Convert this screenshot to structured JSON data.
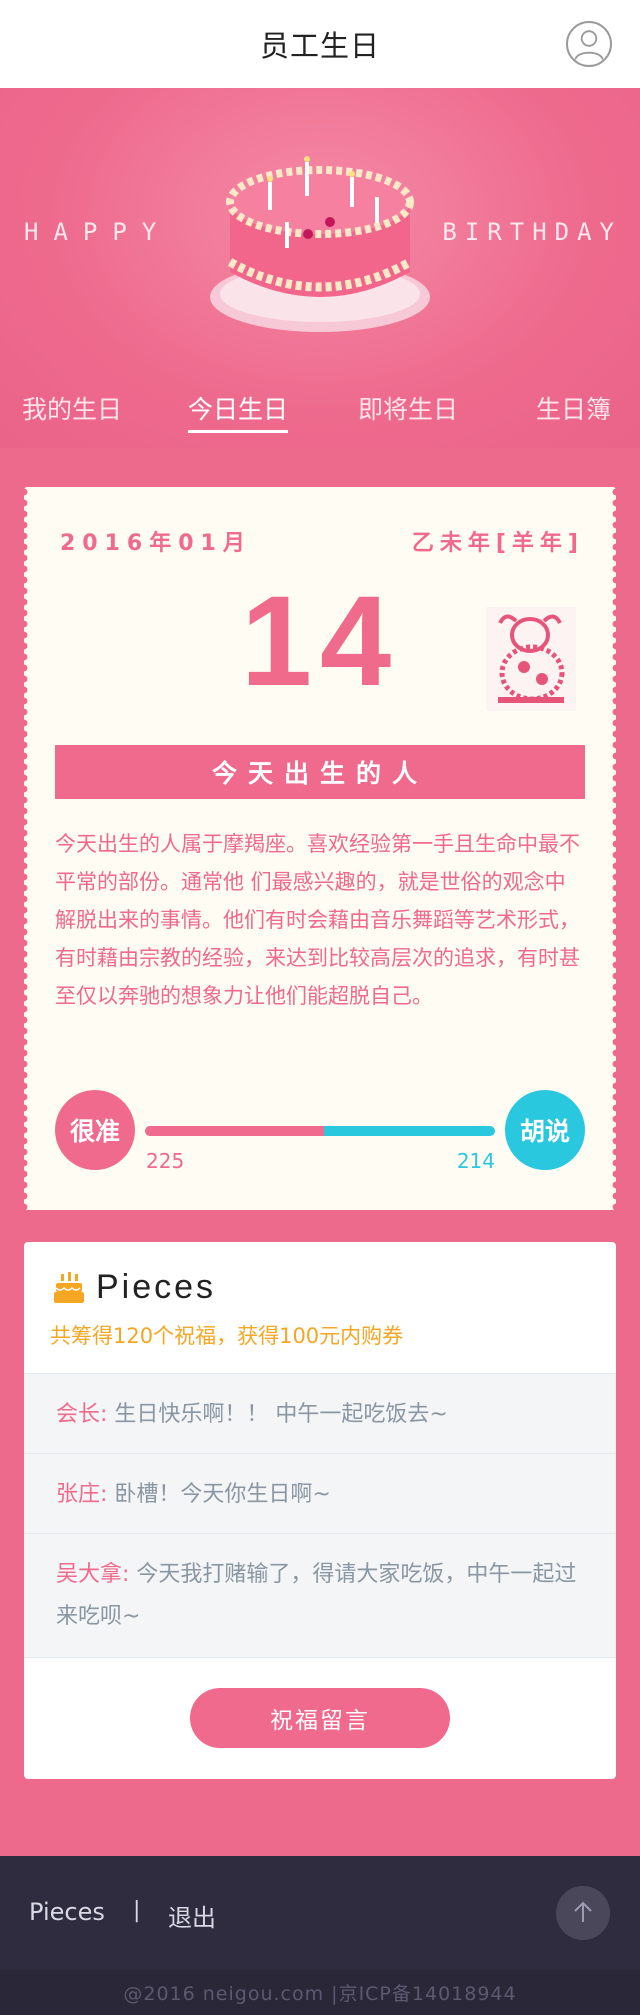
{
  "header": {
    "title": "员工生日",
    "profile_icon": "user-circle-icon"
  },
  "hero": {
    "left_text": "HAPPY",
    "right_text": "BIRTHDAY",
    "image": "birthday-cake"
  },
  "tabs": [
    {
      "label": "我的生日",
      "active": false
    },
    {
      "label": "今日生日",
      "active": true
    },
    {
      "label": "即将生日",
      "active": false
    },
    {
      "label": "生日簿",
      "active": false
    }
  ],
  "calendar": {
    "month": "2016年01月",
    "lunar_year": "乙未年[羊年]",
    "day": "14",
    "zodiac_stamp": "goat-papercut",
    "banner": "今天出生的人",
    "description": "今天出生的人属于摩羯座。喜欢经验第一手且生命中最不平常的部份。通常他 们最感兴趣的，就是世俗的观念中解脱出来的事情。他们有时会藉由音乐舞蹈等艺术形式，有时藉由宗教的经验，来达到比较高层次的追求，有时甚至仅以奔驰的想象力让他们能超脱自己。"
  },
  "vote": {
    "yes_label": "很准",
    "no_label": "胡说",
    "yes_count": "225",
    "no_count": "214",
    "yes_fraction": 0.5125,
    "colors": {
      "yes": "#f06a8d",
      "no": "#29c8de"
    }
  },
  "pieces": {
    "title": "Pieces",
    "summary": "共筹得120个祝福，获得100元内购券",
    "messages": [
      {
        "name": "会长:",
        "text": "生日快乐啊！！ 中午一起吃饭去~"
      },
      {
        "name": "张庄:",
        "text": "卧槽！今天你生日啊~"
      },
      {
        "name": "吴大拿:",
        "text": "今天我打赌输了，得请大家吃饭，中午一起过来吃呗~"
      }
    ],
    "cta": "祝福留言"
  },
  "footer": {
    "link1": "Pieces",
    "separator": "|",
    "link2": "退出",
    "copyright": "@2016 neigou.com |京ICP备14018944"
  },
  "colors": {
    "brand_pink": "#ee6a8d",
    "cyan": "#29c8de",
    "dark": "#2f2c3f"
  }
}
